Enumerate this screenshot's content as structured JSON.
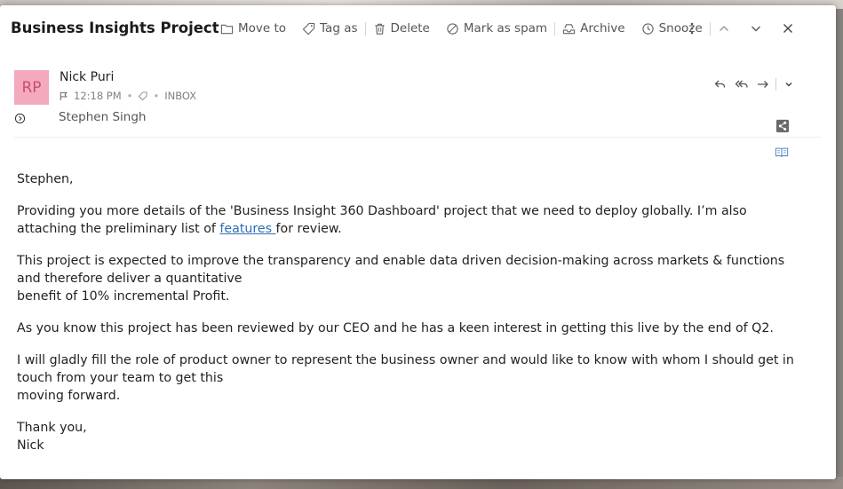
{
  "email": {
    "subject": "Business Insights Project",
    "toolbar": {
      "move_to": "Move to",
      "tag_as": "Tag as",
      "delete": "Delete",
      "mark_as_spam": "Mark as spam",
      "archive": "Archive",
      "snooze": "Snooze"
    },
    "sender": {
      "initials": "RP",
      "name": "Nick Puri",
      "time": "12:18 PM",
      "folder": "INBOX",
      "avatar_color": "#f4a9bd"
    },
    "recipient": "Stephen Singh",
    "body": {
      "greeting": "Stephen,",
      "p1_line1": "Providing you more details of the 'Business Insight 360 Dashboard' project that we need to deploy globally. I’m also",
      "p1_line2_pre": "attaching the preliminary list of ",
      "p1_link": "features ",
      "p1_line2_post": "for review.",
      "p2_line1": "This project is expected to improve the transparency and enable data driven decision-making across markets & functions",
      "p2_line2": "and therefore deliver a quantitative",
      "p2_line3": "benefit of 10% incremental Profit.",
      "p3": "As you know this project has been reviewed by our CEO and he has a keen interest in getting this live by the end of Q2.",
      "p4_line1": "I will gladly fill the role of product owner to represent the business owner and would like to know with whom I should get in",
      "p4_line2": "touch from your team to get this",
      "p4_line3": "moving forward.",
      "closing": "Thank you,",
      "signature": "Nick"
    }
  },
  "colors": {
    "link": "#2e6eb5",
    "avatar_text": "#c8506f"
  }
}
